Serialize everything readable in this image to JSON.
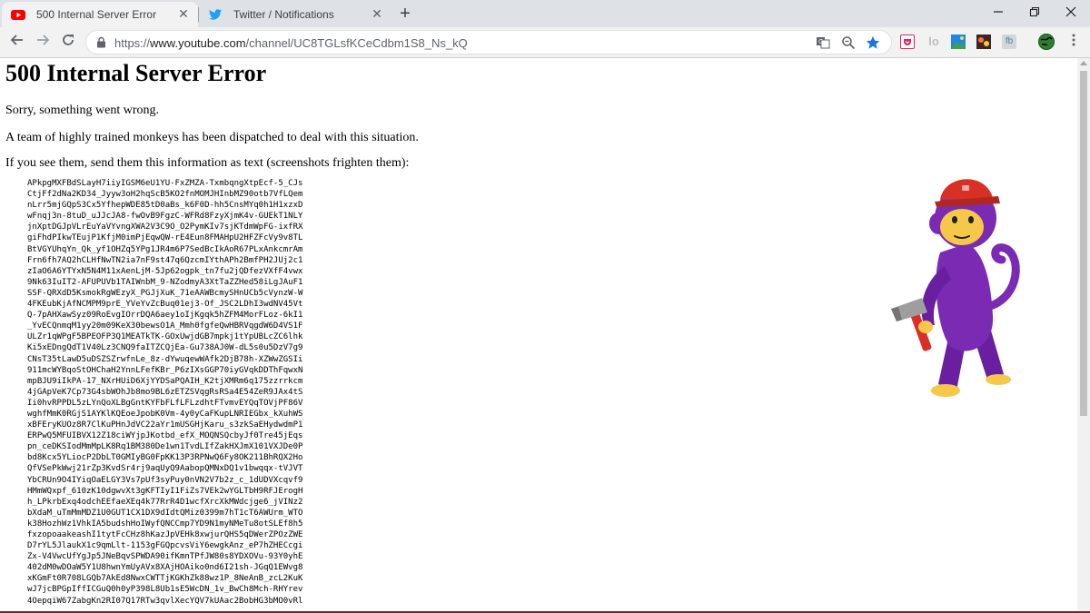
{
  "browser": {
    "tabs": [
      {
        "title": "500 Internal Server Error",
        "favicon": "youtube-icon",
        "active": true
      },
      {
        "title": "Twitter / Notifications",
        "favicon": "twitter-icon",
        "active": false
      }
    ],
    "url": {
      "scheme": "https://",
      "host": "www.youtube.com",
      "path": "/channel/UC8TGLsfKCeCdbm1S8_Ns_kQ"
    }
  },
  "page": {
    "heading": "500 Internal Server Error",
    "line1": "Sorry, something went wrong.",
    "line2": "A team of highly trained monkeys has been dispatched to deal with this situation.",
    "line3": "If you see them, send them this information as text (screenshots frighten them):",
    "error_dump": "APkpgMXFBdSLayH7iiyIGSM6eU1YU-FxZMZA-TxmbqngXtpEcf-5_CJs\nCtjFf2dNa2KD34_Jyyw3oH2hqScB5KO2fnMOMJHInbMZ90otb7VfLQem\nnLrr5mjGQpS3Cx5YfhepWDE85tD0aBs_k6F0D-hh5CnsMYq0h1H1xzxD\nwFnqj3n-8tuD_uJJcJA8-fwOvB9FgzC-WFRd8FzyXjmK4v-GUEkT1NLY\njnXptDGJpVLrEuYaVYvngXWA2V3C9O_O2PymKIv7sjKTdmWpFG-ixfRX\ngiFhdPIkwTEujP1KfjM0imPjEqwQW-rE4Eun8FMAHpU2HFZFcVy9v8TL\nBtVGYUhqYn_Qk_yf1OHZq5YPg1JR4m6P7SedBcIkAoR67PLxAnkcmrAm\nFrn6fh7AQ2hCLHfNwTN2ia7nF9st47q6QzcmIYthAPh2BmfPH2JUj2c1\nzIaO6A6YTYxN5N4M11xAenLjM-5Jp62ogpk_tn7fu2jQDfezVXfF4vwx\n9Nk63IuIT2-AFUPUVb1TAIWnbM_9-NZodmyA3XtTaZZHed58iLgJAuF1\nSSF-QRXdD5KsmokRgWEzyX_PGJjXuK_71eAAWBcmySHnUCb5cVynzW-W\n4FKEubKjAfNCMPM9prE_YVeYvZcBuq01ej3-Of_JSC2LDhI3wdNV45Vt\nQ-7pAHXawSyz09RoEvgIOrrDQA6aey1oIjKgqk5hZFM4MorFLoz-6kI1\n_YvECQnmqM1yy20m09KeX30bewsO1A_Mmh0fgfeQwHBRVqgdW6D4VS1F\nULZr1qWPgF5BPEOFP3Q1MEATkTK-GOxUwjdGB7mpkj1tYpUBLcZC6lhk\nKi5xEDngQdT1V40Lz3CNQ9faITZCQjEa-Gu738AJ0W-dL5s0u5DzV7g9\nCNsT35tLawD5uDSZSZrwfnLe_8z-dYwuqewWAfk2DjB78h-XZWwZGSIi\n911mcWYBqoStOHChaH2YnnLFefKBr_P6zIXsGGP70iyGVqkDDThFqwxN\nmpBJU9iIkPA-17_NXrHUiD6XjYYDSaPQAIH_K2tjXMRm6q175zzrrkcm\n4jGApVeK7Cp73G4sbWOhJb8mo9BL6zETZSVqgRsRSa4E54ZeR9JAx4tS\nIi0hvRPPDL5zLYnQoXLBgGntKYFbFLfLFLzdhtFTvmvEYQqTOVjPF86V\nwghfMmK0RGjS1AYKlKQEoeJpobK0Vm-4y0yCaFKupLNRIEGbx_kXuhWS\nxBFEryKUOz8R7ClKuPHnJdVC22aYr1mUSGHjKaru_s3zkSaEHydwdmP1\nERPwQ5MFUIBVX12Z18ciWYjpJKotbd_efX_MOQNSQcbyJf0Tre45jEqs\npn_ceDKSIodMmMpLK8Rq1BM380De1wn1TvdLIfZakHXJmX101VXJDe0P\nbd8Kcx5YLiocP2DbLT0GMIyBG0FpKK13P3RPNwQ6Fy8OK211BhRQX2Ho\nQfVSePkWwj21rZp3KvdSr4rj9aqUyQ9AabopQMNxDQ1v1bwqqx-tVJVT\nYbCRUn9O4IYiqOaELGY3Vs7pUf3syPuy0nVN2V7b2z_c_1dUDVXcqvf9\nHMmWQxpf_610zK10dgwvXt3gKFTIyI1FiZs7VEk2wYGLTbH9RFJErogH\nh_LPkrbExq4odchEEfaeXEq4k77RrR4D1wcfXrcXkMWdcjge6_jVINz2\nbXdaM_uTmMmMDZ1U0GUT1CX1DX9dIdtQMiz0399m7hT1cT6AWUrm_WTO\nk38HozhWz1VhkIA5budshHoIWyfQNCCmp7YD9N1myNMeTu8otSLEf8h5\nfxzopoaakeashI1tytFcCHz8hKazJpVEHk8xwjurQHS5qDWerZPOzZWE\nD7rYL5JlaukX1c9qmLlt-1153gFGQpcvsViY6ewgkAnz_eP7hZHECcgi\nZx-V4VwcUfYgJp5JNeBqvSPWDA90ifKmnTPfJW80s8YDXOVu-93Y0yhE\n402dM0wDOaW5Y1U8hwnYmUyAVx8XAjHOAiko0nd6I21sh-JGqQ1EWvg8\nxKGmFt0R708LGQb7AkEd8NwxCWTTjKGKhZk88wz1P_8NeAnB_zcL2KuK\nwJ7jcBPGpIffICGuQ0h0yP398L8Ub1sE5WcDN_1v_BwCh8Mch-RHYrev\n4OepqiW67ZabgKn2RI07Q17RTw3qvlXecYQV7kUAac2BobHG3bMO0vRl"
  },
  "colors": {
    "youtube_red": "#ff0000",
    "twitter_blue": "#1da1f2",
    "star_blue": "#1a73e8",
    "monkey_purple": "#7b2ab3",
    "monkey_face": "#f6c84a",
    "hat_red": "#d93025"
  },
  "icons": {
    "back": "arrow-left-icon",
    "forward": "arrow-right-icon",
    "reload": "reload-icon",
    "lock": "lock-icon",
    "translate": "translate-icon",
    "zoom": "zoom-icon",
    "bookmark": "star-icon",
    "menu": "kebab-menu-icon"
  }
}
